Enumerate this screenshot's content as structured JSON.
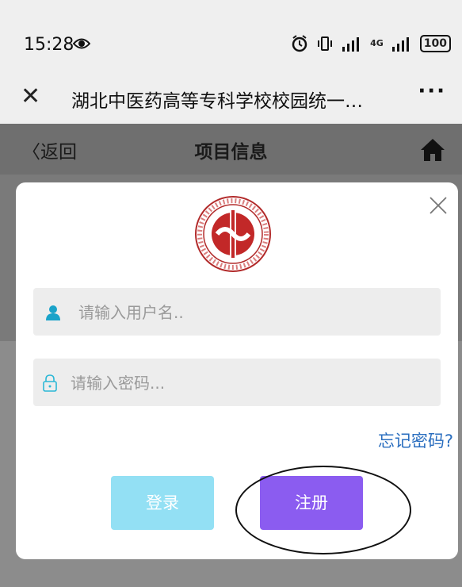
{
  "status_bar": {
    "time": "15:28",
    "network": "4G",
    "battery": "100",
    "icons": [
      "eye-icon",
      "alarm-icon",
      "vibrate-icon",
      "signal-icon",
      "signal-4g-icon",
      "battery-icon"
    ]
  },
  "title_bar": {
    "close": "✕",
    "title": "湖北中医药高等专科学校校园统一…",
    "more": "···"
  },
  "nav": {
    "back_label": "返回",
    "title": "项目信息",
    "home_icon": "home-icon"
  },
  "modal": {
    "logo_icon": "school-emblem-icon",
    "username_placeholder": "请输入用户名..",
    "password_placeholder": "请输入密码...",
    "forgot_label": "忘记密码?",
    "login_label": "登录",
    "register_label": "注册"
  },
  "colors": {
    "accent_login": "#93e0f4",
    "accent_register": "#8b5cf0",
    "link": "#2a6ebf",
    "user_icon": "#1aa3c9",
    "lock_icon": "#2bb8d6"
  }
}
